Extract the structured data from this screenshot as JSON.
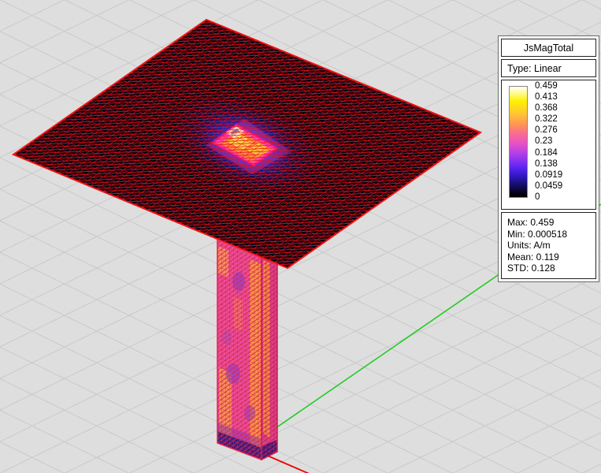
{
  "legend": {
    "title": "JsMagTotal",
    "type_label": "Type: Linear",
    "ticks": [
      "0.459",
      "0.413",
      "0.368",
      "0.322",
      "0.276",
      "0.23",
      "0.184",
      "0.138",
      "0.0919",
      "0.0459",
      "0"
    ],
    "stats": {
      "max": "Max: 0.459",
      "min": "Min: 0.000518",
      "units": "Units: A/m",
      "mean": "Mean: 0.119",
      "std": "STD: 0.128"
    },
    "colormap_top_to_bottom": [
      "#ffffff",
      "#fff000",
      "#ffc337",
      "#ff9058",
      "#f8659b",
      "#e550c8",
      "#a93cec",
      "#6526f4",
      "#3419cd",
      "#181070",
      "#000000"
    ]
  },
  "scene": {
    "plotted_quantity": "JsMagTotal",
    "x_axis_color": "#ee0000",
    "y_axis_color": "#22cc22"
  }
}
